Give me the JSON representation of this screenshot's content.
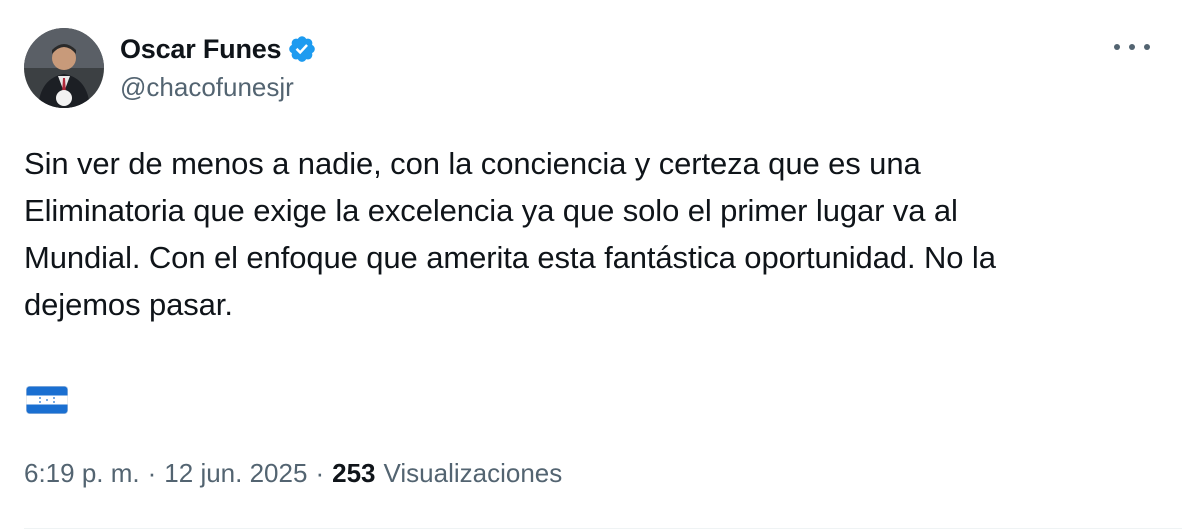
{
  "author": {
    "display_name": "Oscar Funes",
    "handle": "@chacofunesjr",
    "verified": true,
    "verified_color": "#1d9bf0"
  },
  "more_menu_icon": "more-horizontal-icon",
  "tweet": {
    "lines": [
      "Sin ver de menos a nadie, con la conciencia y certeza que es una",
      "Eliminatoria que exige la excelencia ya que solo el primer lugar va al",
      "Mundial. Con el enfoque que amerita esta fantástica oportunidad. No la",
      "dejemos pasar."
    ],
    "emoji": "honduras-flag-icon"
  },
  "meta": {
    "time": "6:19 p. m.",
    "separator": "·",
    "date": "12 jun. 2025",
    "views_count": "253",
    "views_label": "Visualizaciones"
  },
  "colors": {
    "text_primary": "#0f1419",
    "text_secondary": "#536471",
    "flag_blue": "#1a6fd1"
  }
}
